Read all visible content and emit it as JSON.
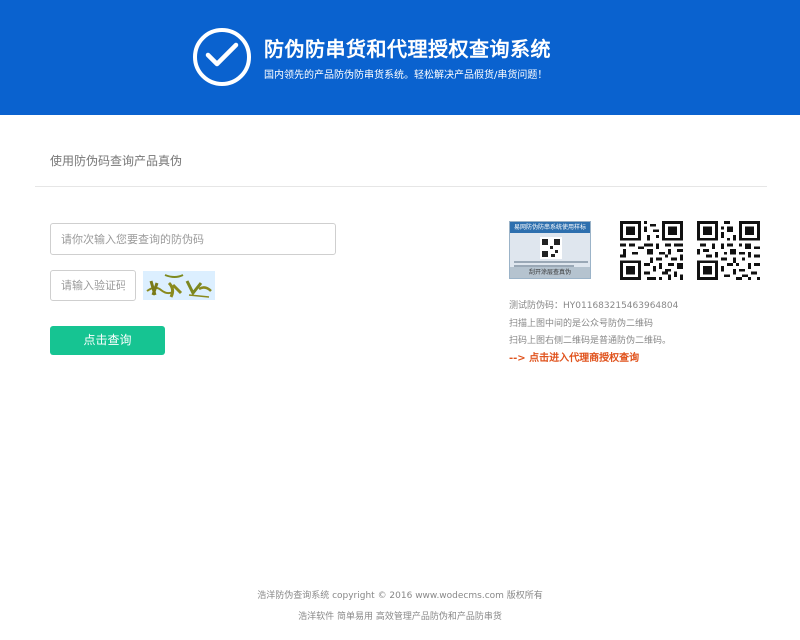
{
  "header": {
    "title": "防伪防串货和代理授权查询系统",
    "subtitle": "国内领先的产品防伪防串货系统。轻松解决产品假货/串货问题！",
    "accent": "#0a62cf"
  },
  "form": {
    "section_title": "使用防伪码查询产品真伪",
    "code_placeholder": "请你次输入您要查询的防伪码",
    "captcha_placeholder": "请输入验证码",
    "submit_label": "点击查询",
    "submit_color": "#16c492"
  },
  "aside": {
    "sample_label_top": "易网防伪防串系统使用样标",
    "sample_label_bottom": "刮开涂层查真伪",
    "test_code": "测试防伪码：HY011683215463964804",
    "hint_1": "扫描上图中间的是公众号防伪二维码",
    "hint_2": "扫码上图右侧二维码是普通防伪二维码。",
    "agent_link": "--> 点击进入代理商授权查询",
    "agent_link_color": "#e0531d"
  },
  "footer": {
    "line_1": "浩洋防伪查询系统 copyright © 2016 www.wodecms.com 版权所有",
    "line_2": "浩洋软件 简单易用 高效管理产品防伪和产品防串货"
  }
}
